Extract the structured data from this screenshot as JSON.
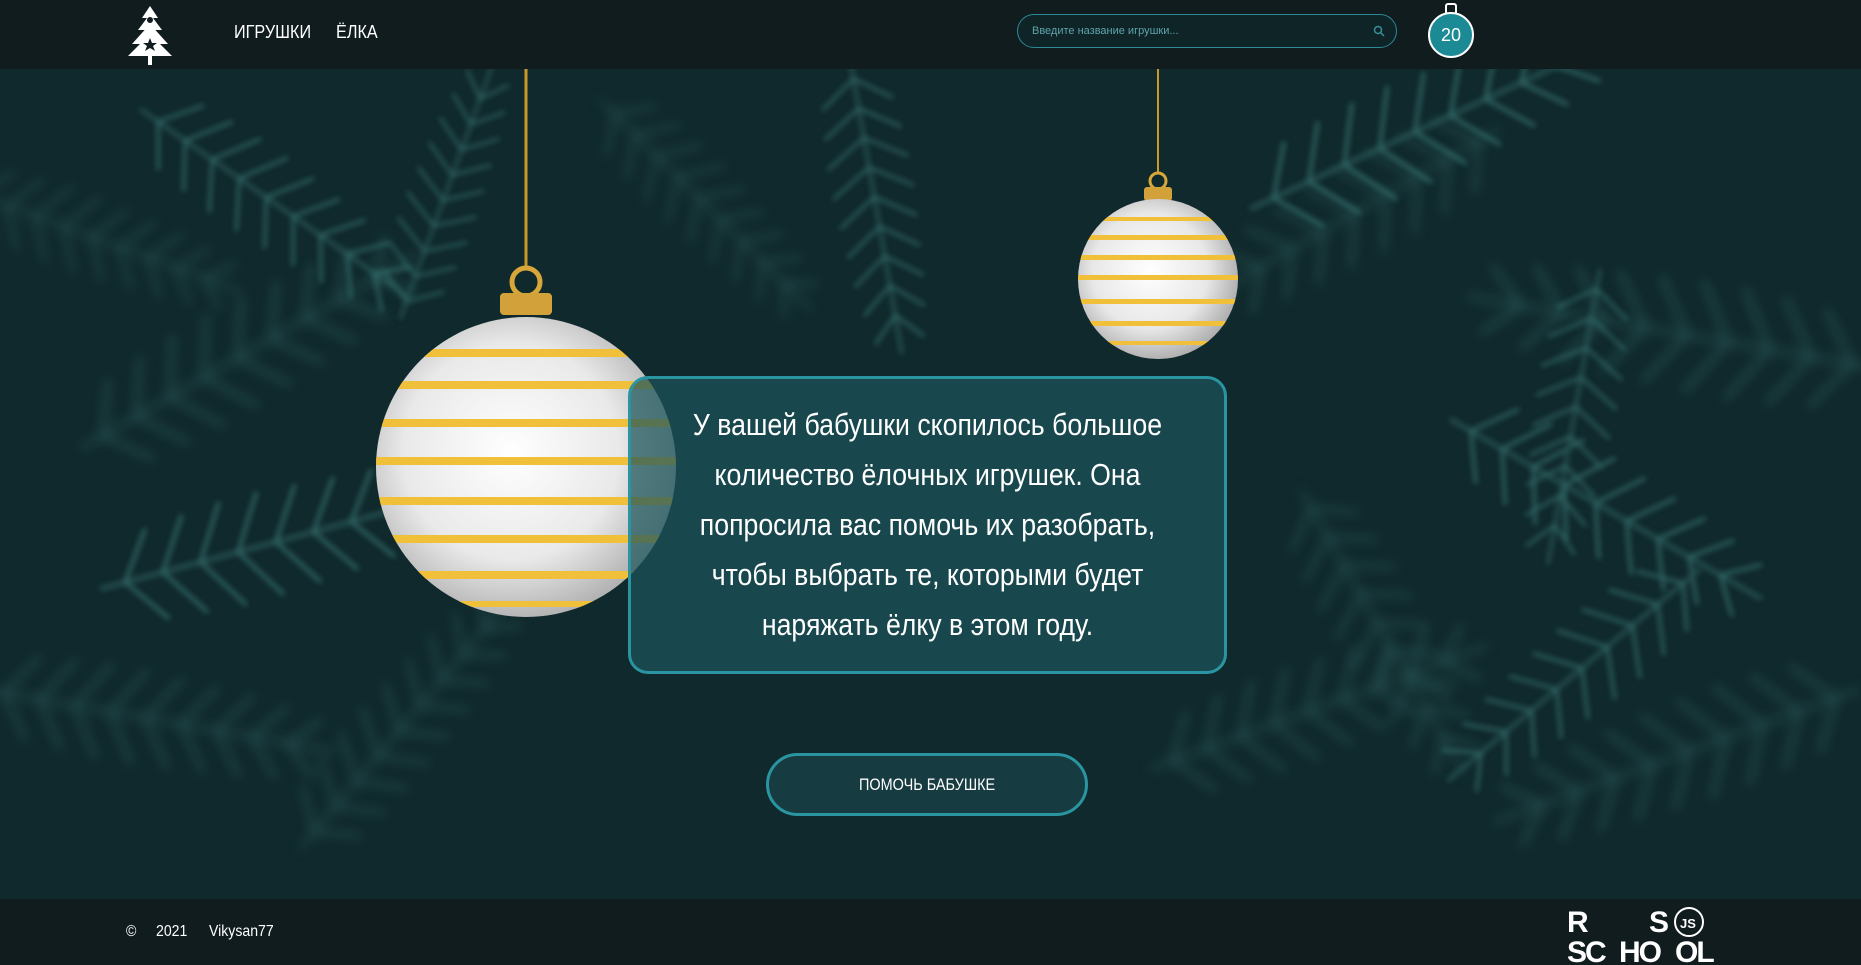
{
  "header": {
    "nav": [
      {
        "label": "ИГРУШКИ"
      },
      {
        "label": "ЁЛКА"
      }
    ],
    "search": {
      "placeholder": "Введите название игрушки..."
    },
    "counter": "20"
  },
  "main": {
    "description": "У вашей бабушки скопилось большое количество ёлочных игрушек. Она попросила вас помочь их разобрать, чтобы выбрать те, которыми будет наряжать ёлку в этом году.",
    "button_label": "ПОМОЧЬ БАБУШКЕ"
  },
  "footer": {
    "copyright_symbol": "©",
    "year": "2021",
    "author": "Vikysan77",
    "school_logo": "RS SCHOOL JS"
  },
  "colors": {
    "accent": "#2a95a1",
    "header_bg": "#111c1f",
    "card_bg": "#1c555c"
  }
}
